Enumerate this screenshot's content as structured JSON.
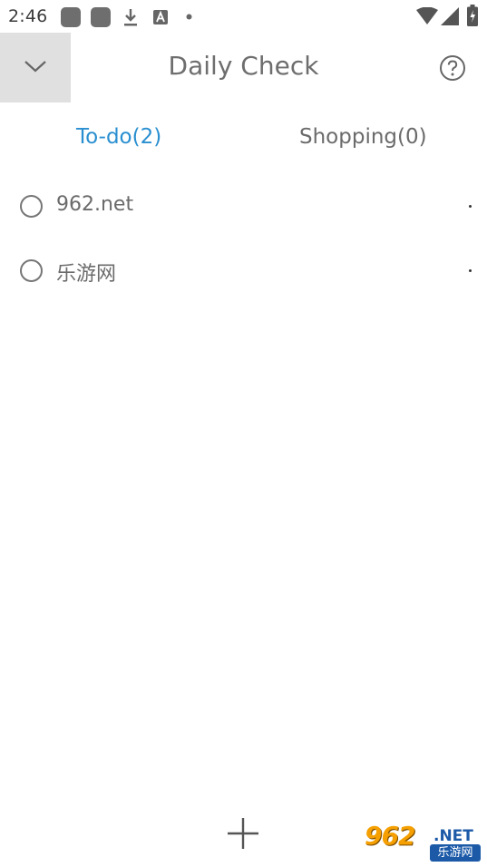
{
  "status_bar": {
    "time": "2:46",
    "icons": [
      "notification-square-icon",
      "notification-square-icon",
      "download-icon",
      "font-a-icon",
      "dot-icon",
      "wifi-icon",
      "cell-signal-icon",
      "battery-charging-icon"
    ]
  },
  "header": {
    "title": "Daily Check",
    "collapse_icon": "chevron-down-icon",
    "help_icon": "help-circle-icon"
  },
  "tabs": [
    {
      "label": "To-do(2)",
      "active": true,
      "color": "#2a8fd0"
    },
    {
      "label": "Shopping(0)",
      "active": false
    }
  ],
  "todo_items": [
    {
      "label": "962.net",
      "checked": false
    },
    {
      "label": "乐游网",
      "checked": false
    }
  ],
  "add_button": {
    "icon": "plus-icon"
  },
  "watermark": {
    "top_text": "962",
    "net_text": ".NET",
    "bottom_text": "乐游网"
  }
}
